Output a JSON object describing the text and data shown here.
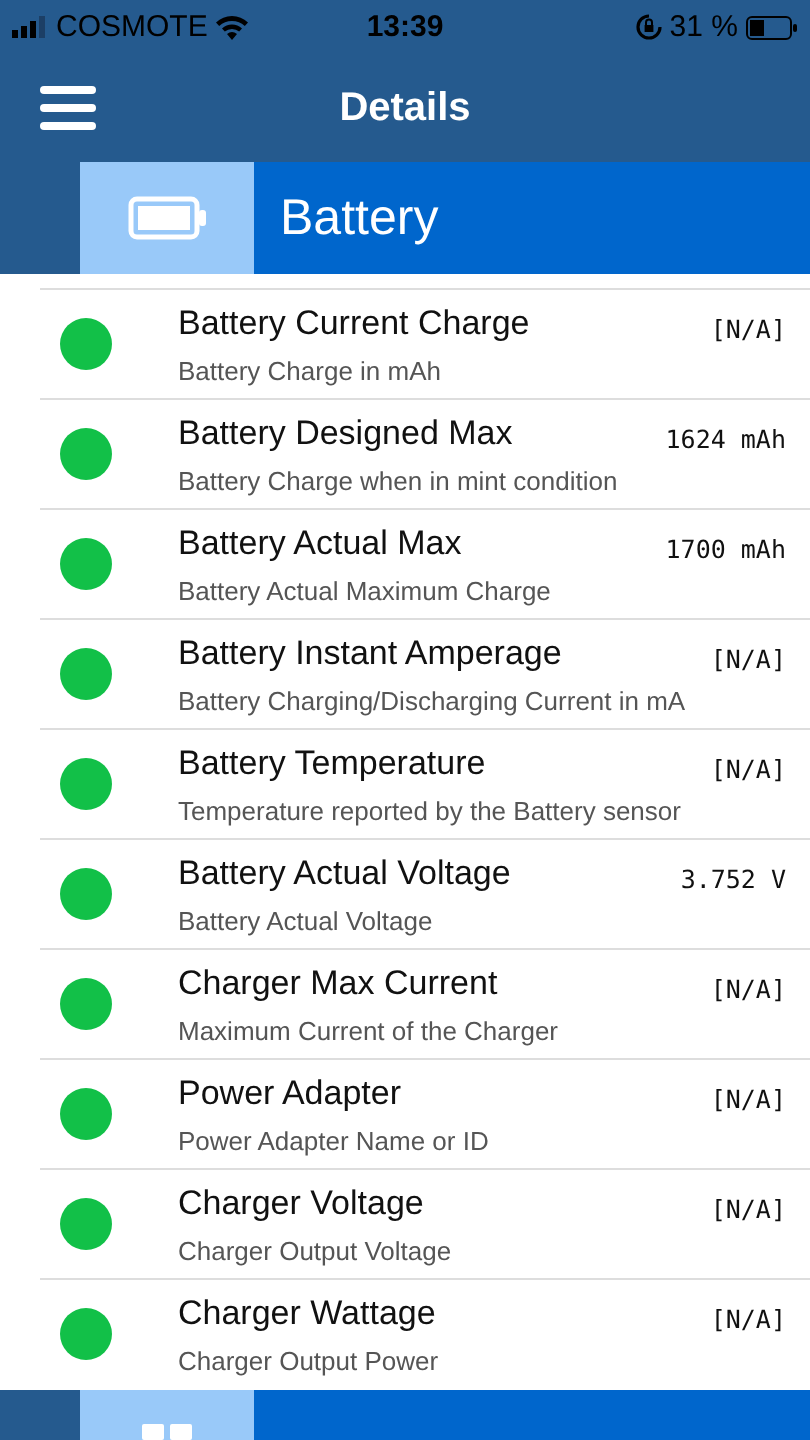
{
  "status_bar": {
    "carrier": "COSMOTE",
    "time": "13:39",
    "battery": "31 %"
  },
  "nav": {
    "title": "Details"
  },
  "section": {
    "title": "Battery"
  },
  "rows": [
    {
      "title": "Battery Current Charge",
      "subtitle": "Battery Charge in mAh",
      "value": "[N/A]",
      "color": "#12c048"
    },
    {
      "title": "Battery Designed Max",
      "subtitle": "Battery Charge when in mint condition",
      "value": "1624 mAh",
      "color": "#12c048"
    },
    {
      "title": "Battery Actual Max",
      "subtitle": "Battery Actual Maximum Charge",
      "value": "1700 mAh",
      "color": "#12c048"
    },
    {
      "title": "Battery Instant Amperage",
      "subtitle": "Battery Charging/Discharging Current in mA",
      "value": "[N/A]",
      "color": "#12c048"
    },
    {
      "title": "Battery Temperature",
      "subtitle": "Temperature reported by the Battery sensor",
      "value": "[N/A]",
      "color": "#12c048"
    },
    {
      "title": "Battery Actual Voltage",
      "subtitle": "Battery Actual Voltage",
      "value": "3.752 V",
      "color": "#12c048"
    },
    {
      "title": "Charger Max Current",
      "subtitle": "Maximum Current of the Charger",
      "value": "[N/A]",
      "color": "#12c048"
    },
    {
      "title": "Power Adapter",
      "subtitle": "Power Adapter Name or ID",
      "value": "[N/A]",
      "color": "#12c048"
    },
    {
      "title": "Charger Voltage",
      "subtitle": "Charger Output Voltage",
      "value": "[N/A]",
      "color": "#12c048"
    },
    {
      "title": "Charger Wattage",
      "subtitle": "Charger Output Power",
      "value": "[N/A]",
      "color": "#12c048"
    }
  ]
}
